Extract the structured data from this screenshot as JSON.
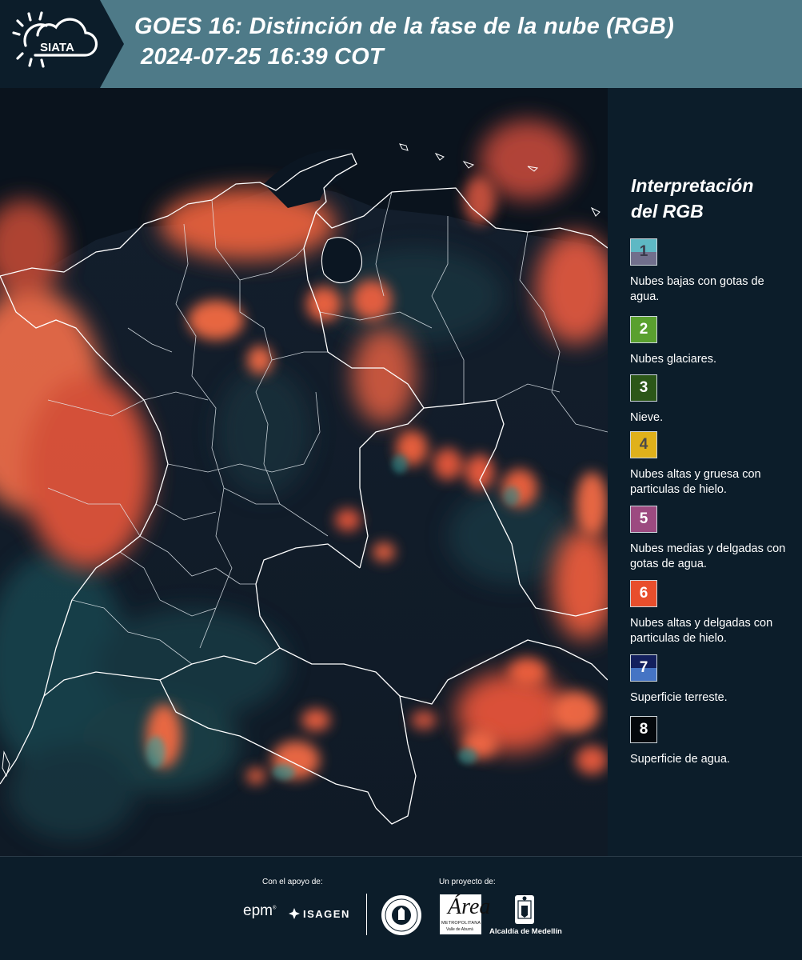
{
  "header": {
    "logo_text": "SIATA",
    "title_line1": "GOES 16: Distinción de la fase de la nube (RGB)",
    "title_line2": "2024-07-25 16:39 COT"
  },
  "legend": {
    "title_line1": "Interpretación",
    "title_line2": "del RGB",
    "items": [
      {
        "number": "1",
        "text": "Nubes bajas con gotas de agua.",
        "color_top": "#5eb8c4",
        "color_bottom": "#716f8c",
        "number_color": "#3a3a4a"
      },
      {
        "number": "2",
        "text": "Nubes glaciares.",
        "color_top": "#5aa02f",
        "color_bottom": "#5aa02f",
        "number_color": "#ffffff"
      },
      {
        "number": "3",
        "text": "Nieve.",
        "color_top": "#2c5718",
        "color_bottom": "#2c5718",
        "number_color": "#ffffff"
      },
      {
        "number": "4",
        "text": "Nubes altas y gruesa con particulas de hielo.",
        "color_top": "#e0b11b",
        "color_bottom": "#e0b11b",
        "number_color": "#4a4a4a"
      },
      {
        "number": "5",
        "text": "Nubes medias y delgadas con gotas de agua.",
        "color_top": "#9c4a80",
        "color_bottom": "#9c4a80",
        "number_color": "#ffffff"
      },
      {
        "number": "6",
        "text": "Nubes altas y delgadas con particulas de hielo.",
        "color_top": "#e84e2c",
        "color_bottom": "#e84e2c",
        "number_color": "#ffffff"
      },
      {
        "number": "7",
        "text": "Superficie terreste.",
        "color_top": "#13205e",
        "color_bottom": "#4574c4",
        "number_color": "#ffffff"
      },
      {
        "number": "8",
        "text": "Superficie de agua.",
        "color_top": "#04080c",
        "color_bottom": "#04080c",
        "number_color": "#ffffff"
      }
    ]
  },
  "footer": {
    "support_label": "Con el apoyo de:",
    "project_label": "Un proyecto de:",
    "epm_text": "epm",
    "epm_mark": "®",
    "isagen_text": "ISAGEN",
    "area_text": "Área",
    "area_sub": "METROPOLITANA",
    "area_sub2": "Valle de Aburrá",
    "alcaldia_text": "Alcaldía de Medellín"
  },
  "colors": {
    "header_bar": "#4e7a88",
    "panel_dark": "#0c1d2a",
    "cloud_orange": "#f26a45",
    "cloud_cyan": "#2a8f96",
    "border_white": "#ffffff"
  }
}
